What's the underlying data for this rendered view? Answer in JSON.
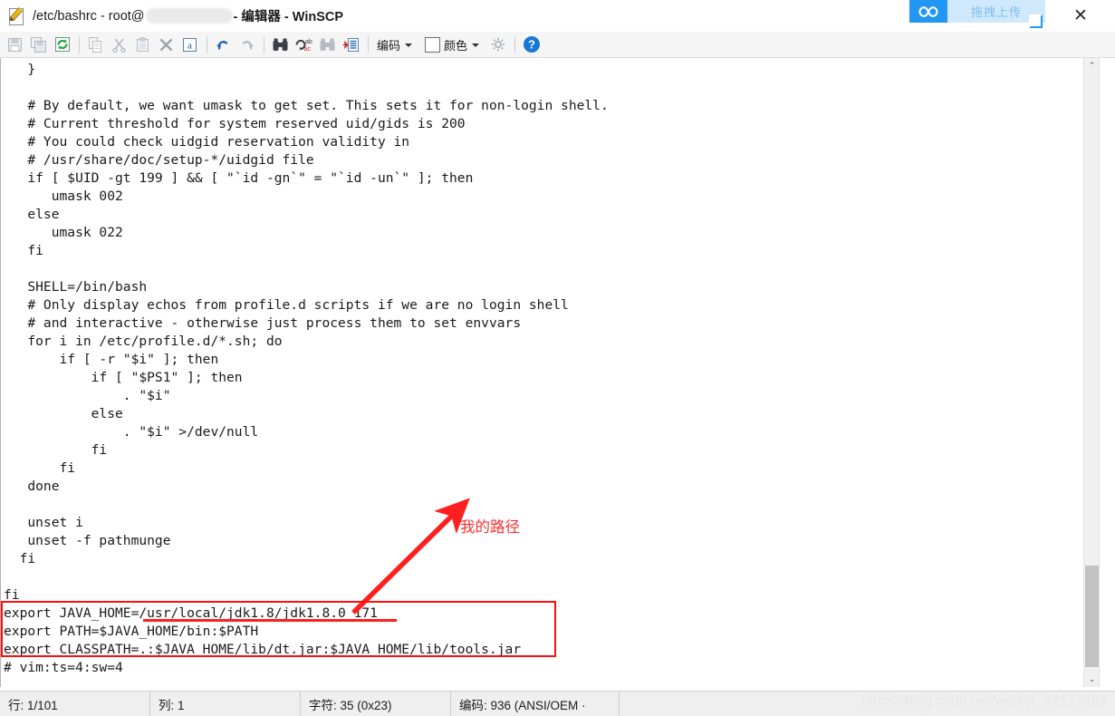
{
  "window": {
    "title_prefix": "/etc/bashrc - root@",
    "title_suffix": "- 编辑器 - WinSCP",
    "title_icon": "edit-document-icon",
    "close_label": "✕"
  },
  "drag_badge": {
    "icon": "infinity-icon",
    "icon_glyph": "∞",
    "label": "拖拽上传",
    "accent_color": "#2196f3",
    "label_bg": "#cfe8fb"
  },
  "toolbar": {
    "buttons": [
      {
        "name": "save-button",
        "icon": "floppy-disk-icon",
        "enabled": false
      },
      {
        "name": "save-as-button",
        "icon": "copy-floppy-icon",
        "enabled": false
      },
      {
        "name": "reload-button",
        "icon": "refresh-icon",
        "enabled": true
      },
      {
        "name": "copy-button",
        "icon": "copy-icon",
        "enabled": false
      },
      {
        "name": "cut-button",
        "icon": "scissors-icon",
        "enabled": false
      },
      {
        "name": "paste-button",
        "icon": "clipboard-icon",
        "enabled": false
      },
      {
        "name": "delete-button",
        "icon": "x-cross-icon",
        "enabled": false
      },
      {
        "name": "select-all-button",
        "icon": "select-all-a-icon",
        "enabled": true
      },
      {
        "name": "undo-button",
        "icon": "undo-arrow-icon",
        "enabled": true
      },
      {
        "name": "redo-button",
        "icon": "redo-arrow-icon",
        "enabled": false
      },
      {
        "name": "find-button",
        "icon": "binoculars-icon",
        "enabled": true
      },
      {
        "name": "replace-button",
        "icon": "replace-ab-ac-icon",
        "enabled": true
      },
      {
        "name": "find-next-button",
        "icon": "binoculars-next-icon",
        "enabled": false
      },
      {
        "name": "go-to-line-button",
        "icon": "goto-line-icon",
        "enabled": true
      }
    ],
    "encoding_label": "编码",
    "color_label": "颜色",
    "settings_icon": "gear-icon",
    "help_icon": "help-question-icon"
  },
  "editor": {
    "code": "   }\n\n   # By default, we want umask to get set. This sets it for non-login shell.\n   # Current threshold for system reserved uid/gids is 200\n   # You could check uidgid reservation validity in\n   # /usr/share/doc/setup-*/uidgid file\n   if [ $UID -gt 199 ] && [ \"`id -gn`\" = \"`id -un`\" ]; then\n      umask 002\n   else\n      umask 022\n   fi\n\n   SHELL=/bin/bash\n   # Only display echos from profile.d scripts if we are no login shell\n   # and interactive - otherwise just process them to set envvars\n   for i in /etc/profile.d/*.sh; do\n       if [ -r \"$i\" ]; then\n           if [ \"$PS1\" ]; then\n               . \"$i\"\n           else\n               . \"$i\" >/dev/null\n           fi\n       fi\n   done\n\n   unset i\n   unset -f pathmunge\n  fi\n\nfi\nexport JAVA_HOME=/usr/local/jdk1.8/jdk1.8.0_171\nexport PATH=$JAVA_HOME/bin:$PATH\nexport CLASSPATH=.:$JAVA_HOME/lib/dt.jar:$JAVA_HOME/lib/tools.jar\n# vim:ts=4:sw=4\n"
  },
  "annotations": {
    "arrow_label": "我的路径",
    "arrow_color": "#ff2d2d",
    "box_color": "#ff0d0d"
  },
  "statusbar": {
    "line": "行: 1/101",
    "column": "列: 1",
    "character": "字符: 35 (0x23)",
    "encoding": "编码: 936  (ANSI/OEM ·",
    "extra": ""
  },
  "watermark": {
    "text": "https://blog.csdn.net/weixin_42173451"
  },
  "scrollbar": {
    "up_arrow": "⌃",
    "down_arrow": "⌄"
  }
}
